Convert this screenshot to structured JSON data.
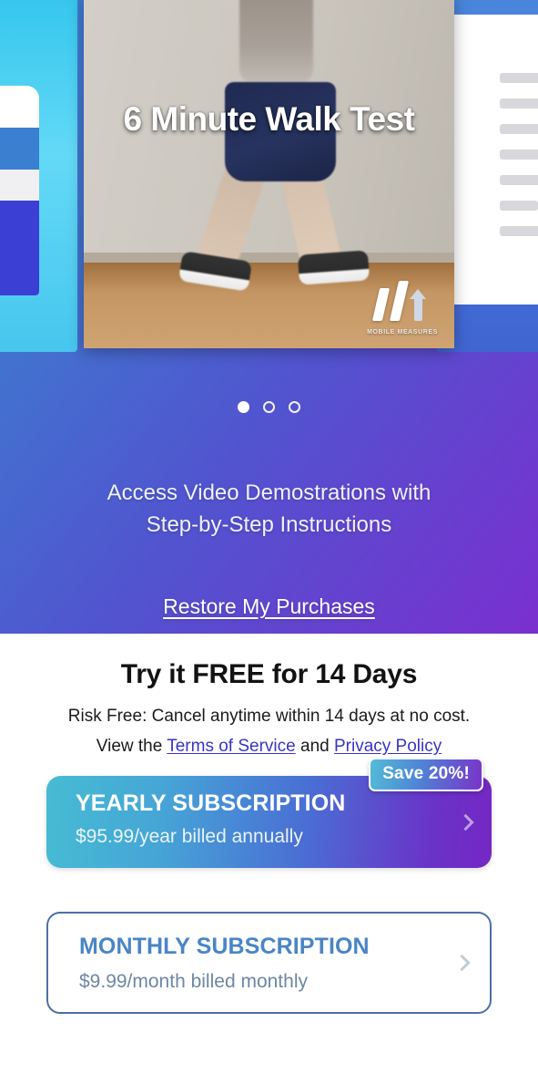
{
  "hero": {
    "carousel": {
      "slide_title": "6 Minute Walk Test",
      "logo_text": "MOBILE MEASURES",
      "dots": [
        {
          "state": "active"
        },
        {
          "state": "idle"
        },
        {
          "state": "idle"
        }
      ]
    },
    "tagline_line1": "Access Video Demostrations with",
    "tagline_line2": "Step-by-Step Instructions",
    "restore_label": "Restore My Purchases"
  },
  "paywall": {
    "headline": "Try it FREE for 14 Days",
    "subline": "Risk Free: Cancel anytime within 14 days at no cost.",
    "legal_prefix": "View the ",
    "legal_terms": "Terms of Service",
    "legal_conjunction": " and ",
    "legal_privacy": "Privacy Policy",
    "plans": [
      {
        "id": "yearly",
        "title": "YEARLY SUBSCRIPTION",
        "price_detail": "$95.99/year billed annually",
        "badge": "Save 20%!"
      },
      {
        "id": "monthly",
        "title": "MONTHLY SUBSCRIPTION",
        "price_detail": "$9.99/month billed monthly"
      }
    ]
  },
  "colors": {
    "hero_gradient_start": "#3f7fd4",
    "hero_gradient_end": "#7a2fcf",
    "yearly_gradient_start": "#46bcd3",
    "yearly_gradient_end": "#7527c4",
    "monthly_border": "#4d6fa8",
    "monthly_title": "#4a85c6",
    "monthly_sub": "#6d87a6",
    "link": "#3a34c4",
    "headline": "#121212"
  }
}
